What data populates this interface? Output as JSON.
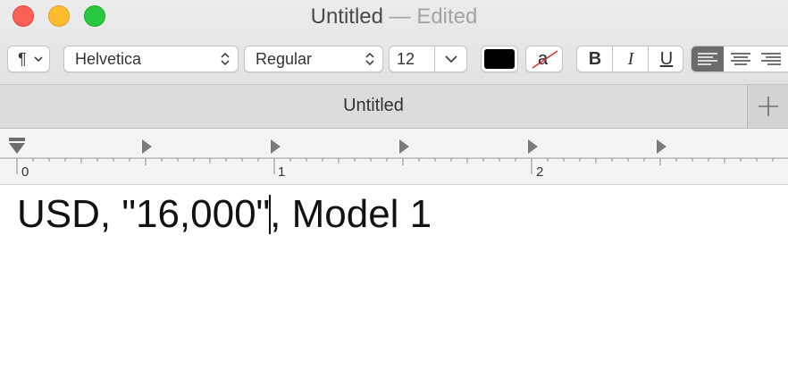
{
  "window": {
    "title": "Untitled",
    "title_status": " — Edited"
  },
  "toolbar": {
    "paragraph_icon": "pilcrow-icon",
    "paragraph_glyph": "¶",
    "font_family": "Helvetica",
    "font_style": "Regular",
    "font_size": "12",
    "text_color": "#000000",
    "bold_label": "B",
    "italic_label": "I",
    "underline_label": "U",
    "background_color_glyph": "a"
  },
  "tabs": {
    "active_label": "Untitled"
  },
  "ruler": {
    "labels": [
      "0",
      "1",
      "2"
    ]
  },
  "document": {
    "text_before_caret": "USD, \"16,000\"",
    "text_after_caret": ", Model 1"
  },
  "colors": {
    "close": "#fd5f57",
    "minimize": "#febc2e",
    "zoom": "#28c840",
    "selected_segment": "#6b6b6b"
  }
}
